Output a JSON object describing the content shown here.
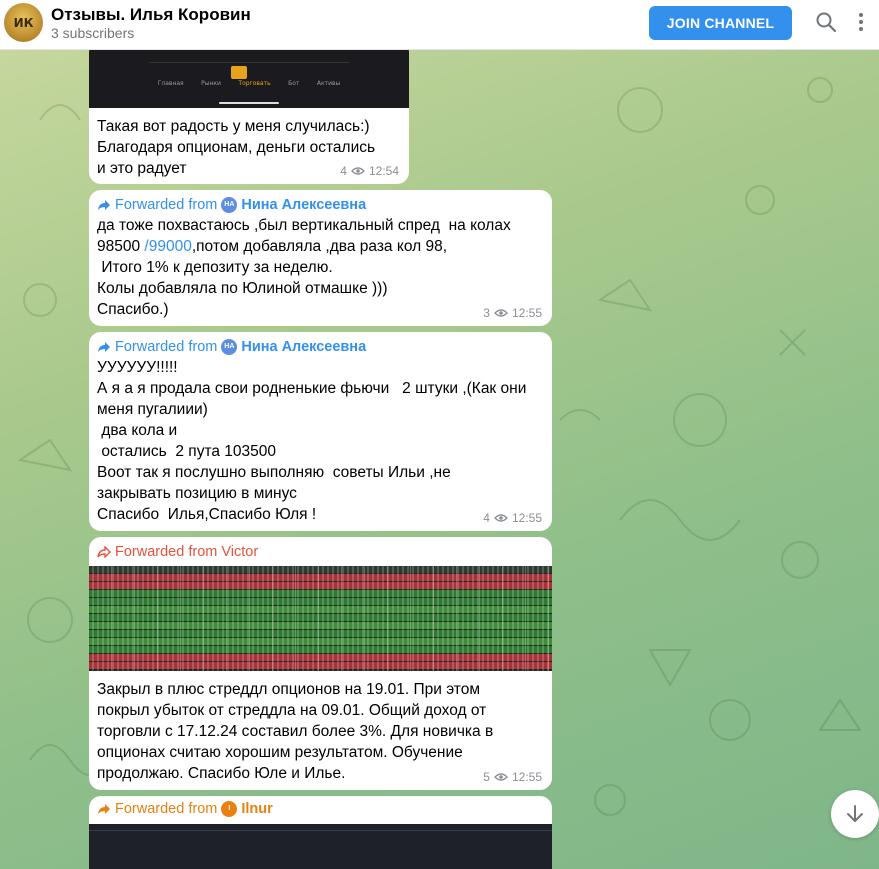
{
  "header": {
    "avatar_initials": "ИК",
    "channel_title": "Отзывы. Илья Коровин",
    "subscribers": "3 subscribers",
    "join_button": "JOIN CHANNEL",
    "search_icon": "search-icon",
    "menu_icon": "more-vertical-icon"
  },
  "messages": [
    {
      "text": "Такая вот радость у меня случилась:)\nБлагодаря опционам, деньги остались\nи это радует",
      "views": "4",
      "time": "12:54",
      "image_tabs": [
        "Главная",
        "Рынки",
        "Торговать",
        "Бот",
        "Активы"
      ]
    },
    {
      "forwarded_label": "Forwarded from",
      "forwarded_from": "Нина Алексеевна",
      "forwarded_initials": "НА",
      "text_before_link": "да тоже похвастаюсь ,был вертикальный спред  на колах\n98500 ",
      "link": "/99000",
      "text_after_link": ",потом добавляла ,два раза кол 98,\n Итого 1% к депозиту за неделю.\nКолы добавляла по Юлиной отмашке )))\nСпасибо.)",
      "views": "3",
      "time": "12:55"
    },
    {
      "forwarded_label": "Forwarded from",
      "forwarded_from": "Нина Алексеевна",
      "forwarded_initials": "НА",
      "text": "УУУУУУ!!!!!\nА я а я продала свои родненькие фьючи   2 штуки ,(Как они\nменя пугалиии)\n два кола и\n остались  2 пута 103500\nВоот так я послушно выполняю  советы Ильи ,не\nзакрывать позицию в минус\nСпасибо  Илья,Спасибо Юля !",
      "views": "4",
      "time": "12:55"
    },
    {
      "forwarded_label": "Forwarded from Victor",
      "text": "Закрыл в плюс стреддл опционов на 19.01. При этом\nпокрыл убыток от стреддла на 09.01. Общий доход от\nторговли с 17.12.24 составил более 3%. Для новичка в\nопционах считаю хорошим результатом. Обучение\nпродолжаю. Спасибо Юле и Илье.",
      "views": "5",
      "time": "12:55"
    },
    {
      "forwarded_label": "Forwarded from",
      "forwarded_from": "Ilnur",
      "forwarded_initials": "I"
    }
  ],
  "colors": {
    "accent": "#3390ec",
    "forward_victor": "#e5533d",
    "table_red": "#a8323a",
    "table_green": "#2f7a33"
  }
}
